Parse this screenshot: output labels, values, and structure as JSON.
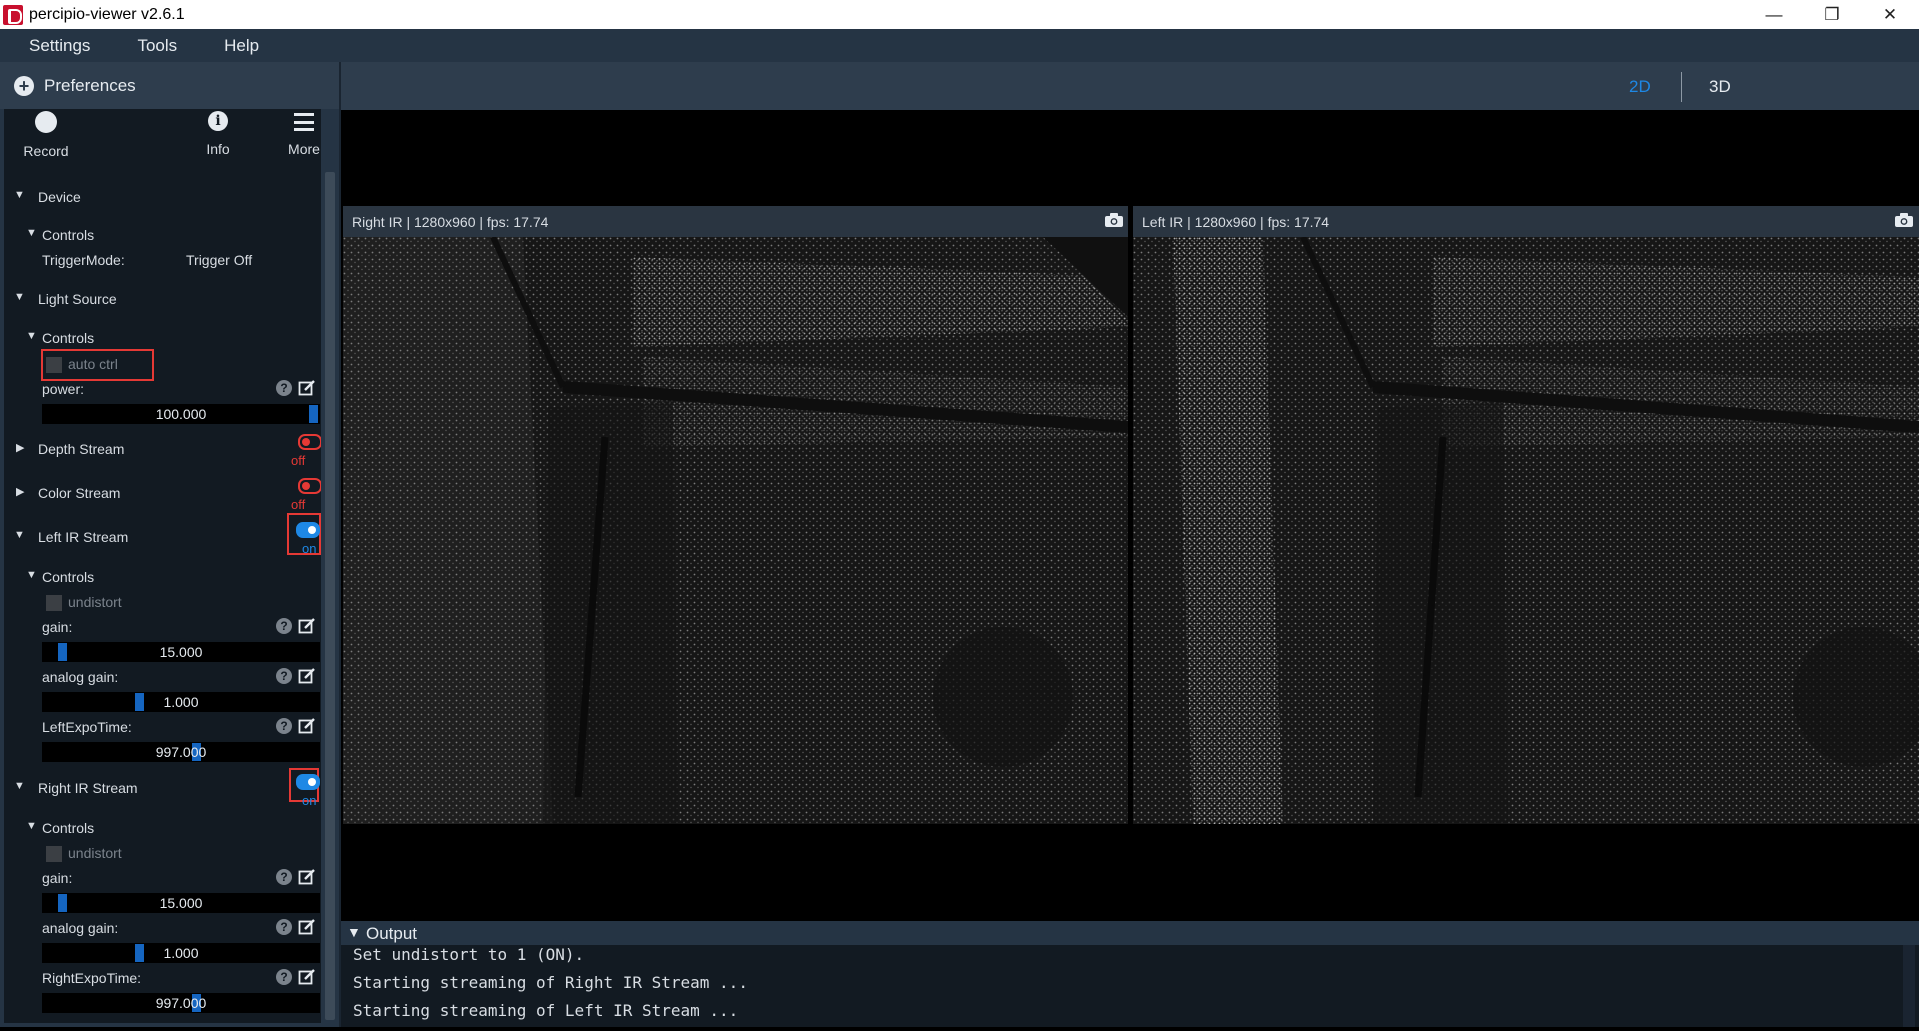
{
  "window": {
    "title": "percipio-viewer v2.6.1",
    "min_glyph": "—",
    "restore_glyph": "❐",
    "close_glyph": "✕"
  },
  "menu": [
    "Settings",
    "Tools",
    "Help"
  ],
  "preferences": {
    "label": "Preferences"
  },
  "toolbar": {
    "record": "Record",
    "info": "Info",
    "more": "More"
  },
  "device": {
    "label": "Device",
    "controls_label": "Controls",
    "trigger_label": "TriggerMode:",
    "trigger_value": "Trigger Off"
  },
  "light_source": {
    "label": "Light Source",
    "controls_label": "Controls",
    "auto_ctrl": "auto ctrl",
    "power_label": "power:",
    "power_value": "100.000",
    "power_fraction": 1.0
  },
  "depth_stream": {
    "label": "Depth Stream",
    "state": "off"
  },
  "color_stream": {
    "label": "Color Stream",
    "state": "off"
  },
  "left_ir": {
    "label": "Left IR Stream",
    "state": "on",
    "controls_label": "Controls",
    "undistort": "undistort",
    "gain_label": "gain:",
    "gain_value": "15.000",
    "analog_label": "analog gain:",
    "analog_value": "1.000",
    "expo_label": "LeftExpoTime:",
    "expo_value": "997.000"
  },
  "right_ir": {
    "label": "Right IR Stream",
    "state": "on",
    "controls_label": "Controls",
    "undistort": "undistort",
    "gain_label": "gain:",
    "gain_value": "15.000",
    "analog_label": "analog gain:",
    "analog_value": "1.000",
    "expo_label": "RightExpoTime:",
    "expo_value": "997.000"
  },
  "view": {
    "tab_2d": "2D",
    "tab_3d": "3D",
    "active": "2D"
  },
  "streams": {
    "right_title": "Right IR | 1280x960 | fps: 17.74",
    "left_title": "Left IR | 1280x960 | fps: 17.74"
  },
  "output": {
    "title": "Output",
    "lines": [
      "Set undistort to 1 (ON).",
      "Starting streaming of Right IR Stream ...",
      "Starting streaming of Left IR Stream ..."
    ]
  },
  "colors": {
    "accent": "#1e88e5",
    "off_red": "#e53935",
    "panel_bg": "#121a22",
    "bar_bg": "#253444"
  }
}
